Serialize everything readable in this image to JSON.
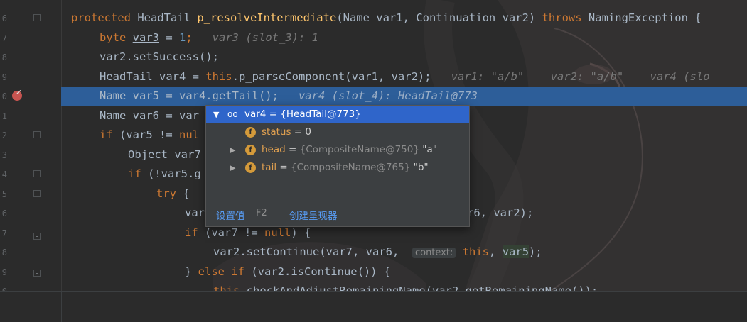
{
  "gutter": {
    "line_numbers": [
      "6",
      "7",
      "8",
      "9",
      "0",
      "1",
      "2",
      "3",
      "4",
      "5",
      "6",
      "7",
      "8",
      "9",
      "0"
    ]
  },
  "code_lines": [
    {
      "segments": [
        {
          "t": "protected ",
          "c": "kw"
        },
        {
          "t": "HeadTail ",
          "c": ""
        },
        {
          "t": "p_resolveIntermediate",
          "c": "fn"
        },
        {
          "t": "(Name var1, Continuation var2) ",
          "c": ""
        },
        {
          "t": "throws ",
          "c": "kw"
        },
        {
          "t": "NamingException {",
          "c": ""
        }
      ],
      "indent": 0
    },
    {
      "segments": [
        {
          "t": "byte ",
          "c": "kw"
        },
        {
          "t": "var3",
          "c": "var"
        },
        {
          "t": " = ",
          "c": ""
        },
        {
          "t": "1",
          "c": "num"
        },
        {
          "t": ";   ",
          "c": "kw"
        },
        {
          "t": "var3 (slot_3): 1",
          "c": "hint"
        }
      ],
      "indent": 1
    },
    {
      "segments": [
        {
          "t": "var2.setSuccess();",
          "c": ""
        }
      ],
      "indent": 1
    },
    {
      "segments": [
        {
          "t": "HeadTail var4 = ",
          "c": ""
        },
        {
          "t": "this",
          "c": "kw"
        },
        {
          "t": ".p_parseComponent(var1, var2);   ",
          "c": ""
        },
        {
          "t": "var1: \"a/b\"    var2: \"a/b\"    var4 (slo",
          "c": "hint"
        }
      ],
      "indent": 1
    },
    {
      "segments": [
        {
          "t": "Name var5 = var4.getTail();   ",
          "c": ""
        },
        {
          "t": "var4 (slot_4): HeadTail@773",
          "c": "hint sel"
        }
      ],
      "indent": 1,
      "highlight": true
    },
    {
      "segments": [
        {
          "t": "Name var6 = var",
          "c": ""
        }
      ],
      "indent": 1
    },
    {
      "segments": [
        {
          "t": "if ",
          "c": "kw"
        },
        {
          "t": "(var5 != ",
          "c": ""
        },
        {
          "t": "nul",
          "c": "kw"
        }
      ],
      "indent": 1
    },
    {
      "segments": [
        {
          "t": "Object var7",
          "c": ""
        }
      ],
      "indent": 2
    },
    {
      "segments": [
        {
          "t": "if ",
          "c": "kw"
        },
        {
          "t": "(!var5.g",
          "c": ""
        }
      ],
      "indent": 2
    },
    {
      "segments": [
        {
          "t": "try ",
          "c": "kw"
        },
        {
          "t": "{",
          "c": ""
        }
      ],
      "indent": 3
    },
    {
      "segments": [
        {
          "t": "var",
          "c": ""
        }
      ],
      "indent": 4,
      "tail": [
        {
          "t": "r6, var2);",
          "c": ""
        }
      ]
    },
    {
      "segments": [
        {
          "t": "if ",
          "c": "kw"
        },
        {
          "t": "(var7 != ",
          "c": ""
        },
        {
          "t": "null",
          "c": "kw"
        },
        {
          "t": ") {",
          "c": ""
        }
      ],
      "indent": 4
    },
    {
      "segments": [
        {
          "t": "var2.setContinue(var7, var6,  ",
          "c": ""
        },
        {
          "t": "context:",
          "c": "ctx"
        },
        {
          "t": " this",
          "c": "kw"
        },
        {
          "t": ", ",
          "c": ""
        },
        {
          "t": "var5",
          "c": "vbox"
        },
        {
          "t": ");",
          "c": ""
        }
      ],
      "indent": 5
    },
    {
      "segments": [
        {
          "t": "} ",
          "c": ""
        },
        {
          "t": "else if ",
          "c": "kw"
        },
        {
          "t": "(var2.isContinue()) {",
          "c": ""
        }
      ],
      "indent": 4
    },
    {
      "segments": [
        {
          "t": "this",
          "c": "kw"
        },
        {
          "t": ".checkAndAdjustRemainingName(var2.getRemainingName());",
          "c": ""
        }
      ],
      "indent": 5
    }
  ],
  "popup": {
    "root": {
      "name": "var4",
      "value": "= {HeadTail@773}"
    },
    "fields": [
      {
        "name": "status",
        "eq": " = ",
        "type": "",
        "value": "0",
        "expandable": false
      },
      {
        "name": "head",
        "eq": " = ",
        "type": "{CompositeName@750} ",
        "value": "\"a\"",
        "expandable": true
      },
      {
        "name": "tail",
        "eq": " = ",
        "type": "{CompositeName@765} ",
        "value": "\"b\"",
        "expandable": true
      }
    ],
    "set_value_label": "设置值",
    "set_value_shortcut": "F2",
    "create_renderer_label": "创建呈现器"
  },
  "colors": {
    "keyword": "#cc7832",
    "function": "#ffc66d",
    "number": "#6897bb",
    "selection": "#2d5e99",
    "popup_selection": "#2f65ca",
    "link": "#589df6"
  }
}
